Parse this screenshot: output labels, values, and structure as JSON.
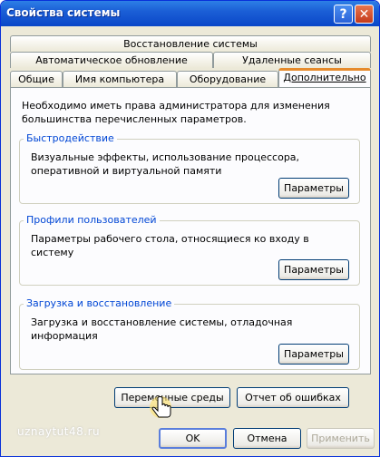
{
  "window": {
    "title": "Свойства системы"
  },
  "tabs": {
    "row1": [
      "Восстановление системы"
    ],
    "row2": [
      "Автоматическое обновление",
      "Удаленные сеансы"
    ],
    "row3": [
      "Общие",
      "Имя компьютера",
      "Оборудование",
      "Дополнительно"
    ]
  },
  "panel": {
    "intro": "Необходимо иметь права администратора для изменения большинства перечисленных параметров.",
    "performance": {
      "title": "Быстродействие",
      "text": "Визуальные эффекты, использование процессора, оперативной и виртуальной памяти",
      "button": "Параметры"
    },
    "profiles": {
      "title": "Профили пользователей",
      "text": "Параметры рабочего стола, относящиеся ко входу в систему",
      "button": "Параметры"
    },
    "startup": {
      "title": "Загрузка и восстановление",
      "text": "Загрузка и восстановление системы, отладочная информация",
      "button": "Параметры"
    }
  },
  "env_button": "Переменные среды",
  "error_button": "Отчет об ошибках",
  "footer": {
    "ok": "OK",
    "cancel": "Отмена",
    "apply": "Применить"
  },
  "watermark": "uznaytut48.ru"
}
